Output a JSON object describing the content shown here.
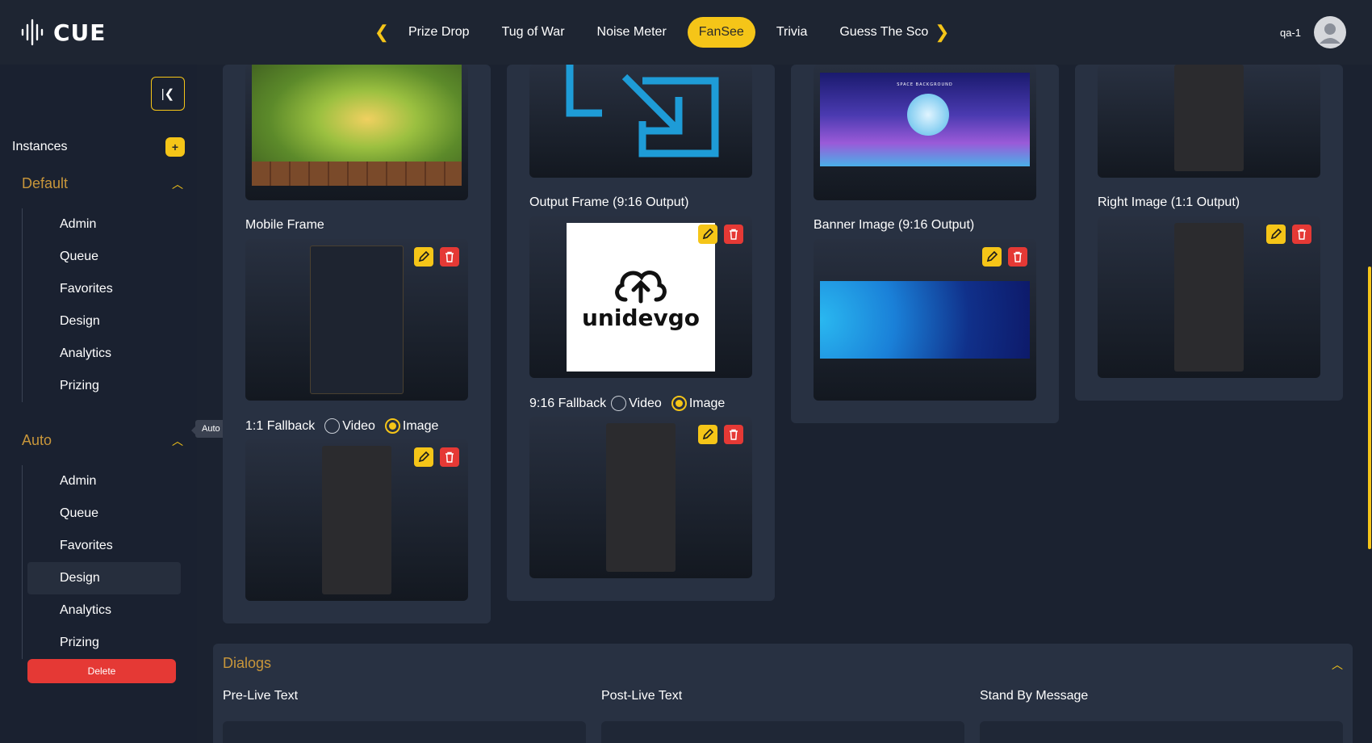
{
  "app": {
    "brand": "CUE"
  },
  "nav": {
    "tabs": [
      "Prize Drop",
      "Tug of War",
      "Noise Meter",
      "FanSee",
      "Trivia",
      "Guess The Sco"
    ],
    "active": "FanSee"
  },
  "user": {
    "name": "qa-1"
  },
  "sidebar": {
    "instances_label": "Instances",
    "groups": [
      {
        "label": "Default",
        "items": [
          "Admin",
          "Queue",
          "Favorites",
          "Design",
          "Analytics",
          "Prizing"
        ]
      },
      {
        "label": "Auto",
        "items": [
          "Admin",
          "Queue",
          "Favorites",
          "Design",
          "Analytics",
          "Prizing"
        ]
      }
    ],
    "selected_item": "Design",
    "delete_label": "Delete",
    "tooltip": "Auto"
  },
  "cards": {
    "mobile_frame": "Mobile Frame",
    "fallback_1_1": "1:1 Fallback",
    "output_frame": "Output Frame (9:16 Output)",
    "fallback_9_16": "9:16 Fallback",
    "banner_image": "Banner Image (9:16 Output)",
    "right_image": "Right Image (1:1 Output)",
    "video_label": "Video",
    "image_label": "Image",
    "logo_text": "unidevgo",
    "space_caption": "SPACE BACKGROUND"
  },
  "dialogs": {
    "title": "Dialogs",
    "fields": [
      "Pre-Live Text",
      "Post-Live Text",
      "Stand By Message"
    ]
  },
  "colors": {
    "accent": "#f5c518",
    "danger": "#e53935",
    "section": "#c8963a"
  }
}
